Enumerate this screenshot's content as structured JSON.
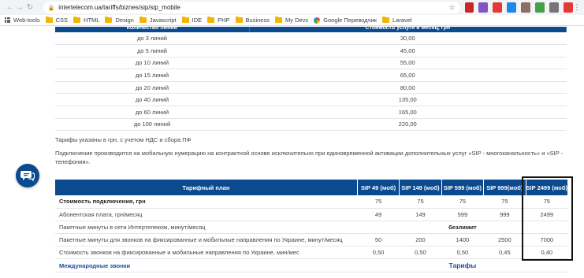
{
  "browser": {
    "url": "intertelecom.ua/tariffs/biznes/sip/sip_mobile",
    "bookmarks": [
      "Web-tools",
      "CSS",
      "HTML",
      "Design",
      "Javascript",
      "IDE",
      "PHP",
      "Business",
      "My Devs",
      "Google Переводчик",
      "Laravel"
    ]
  },
  "lines_table": {
    "header": [
      "Количество линий",
      "Стоимость услуги в месяц, грн"
    ],
    "rows": [
      [
        "до 3 линий",
        "30,00"
      ],
      [
        "до 5 линий",
        "45,00"
      ],
      [
        "до 10 линий",
        "55,00"
      ],
      [
        "до 15 линий",
        "65,00"
      ],
      [
        "до 20 линий",
        "80,00"
      ],
      [
        "до 40 линий",
        "135,00"
      ],
      [
        "до 60 линий",
        "165,00"
      ],
      [
        "до 100 линий",
        "220,00"
      ]
    ]
  },
  "notes": {
    "prices": "Тарифы указаны в грн, с учетом НДС и сбора ПФ",
    "connection": "Подключение производится на мобильную нумерацию на контрактной основе исключительно при единовременной активации дополнительных услуг «SIP - многоканальность» и «SIP - телефония»."
  },
  "plans_table": {
    "header": {
      "plan": "Тарифный план",
      "cols": [
        "SIP 49 (моб)",
        "SIP 149 (моб)",
        "SIP 599 (моб)",
        "SIP 999(моб)",
        "SIP 2499 (моб)"
      ]
    },
    "rows": [
      {
        "label": "Стоимость подключения, грн",
        "values": [
          "75",
          "75",
          "75",
          "75",
          "75"
        ]
      },
      {
        "label": "Абонентская плата, грн/месяц",
        "values": [
          "49",
          "149",
          "599",
          "999",
          "2499"
        ]
      },
      {
        "label": "Пакетные минуты в сети Интертелеком, минут/месяц",
        "span": "безлимит"
      },
      {
        "label": "Пакетные минуты для звонков на фиксированные и мобильные направления по Украине, минут/месяц",
        "values": [
          "50",
          "200",
          "1400",
          "2500",
          "7000"
        ]
      },
      {
        "label": "Стоимость звонков на фиксированные и мобильные направления по Украине, мин/мес",
        "values": [
          "0,50",
          "0,50",
          "0,50",
          "0,45",
          "0,40"
        ]
      }
    ],
    "link_row": {
      "left": "Международные звонки",
      "right": "Тарифы"
    }
  },
  "colors": {
    "header_blue": "#0c4a8f",
    "link_blue": "#1a4fa3"
  }
}
